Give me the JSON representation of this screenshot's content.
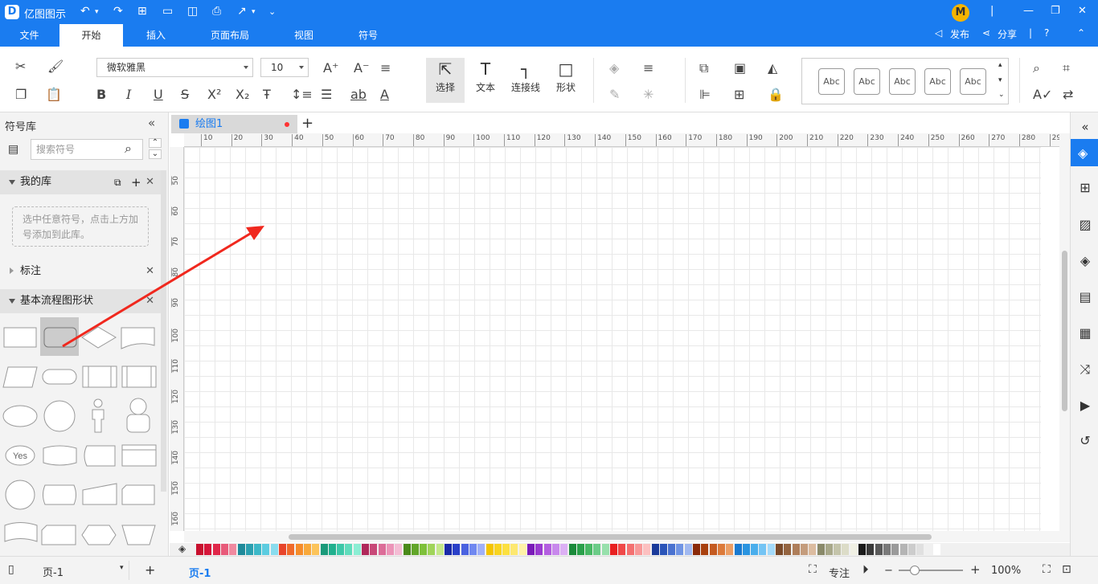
{
  "app": {
    "name": "亿图图示"
  },
  "menu_tabs": [
    "文件",
    "开始",
    "插入",
    "页面布局",
    "视图",
    "符号"
  ],
  "active_tab": "开始",
  "header_right": {
    "publish": "发布",
    "share": "分享",
    "avatar_letter": "M"
  },
  "ribbon": {
    "font_name": "微软雅黑",
    "font_size": "10",
    "tools": {
      "select": "选择",
      "text": "文本",
      "connector": "连接线",
      "shape": "形状"
    },
    "style_samples": [
      "Abc",
      "Abc",
      "Abc",
      "Abc",
      "Abc"
    ]
  },
  "left_panel": {
    "title": "符号库",
    "search_placeholder": "搜索符号",
    "my_library": "我的库",
    "my_library_hint": "选中任意符号，点击上方加号添加到此库。",
    "annotation": "标注",
    "basic_flowchart": "基本流程图形状",
    "yes_label": "Yes"
  },
  "document": {
    "tab_name": "绘图1"
  },
  "ruler": {
    "h_ticks": [
      "10",
      "20",
      "30",
      "40",
      "50",
      "60",
      "70",
      "80",
      "90",
      "100",
      "110",
      "120",
      "130",
      "140",
      "150",
      "160",
      "170",
      "180",
      "190",
      "200",
      "210",
      "220",
      "230",
      "240",
      "250",
      "260",
      "270",
      "280",
      "29"
    ],
    "v_ticks": [
      "50",
      "60",
      "70",
      "80",
      "90",
      "100",
      "110",
      "120",
      "130",
      "140",
      "150",
      "160"
    ]
  },
  "status": {
    "page_select": "页-1",
    "page_tab": "页-1",
    "focus": "专注",
    "zoom": "100%"
  },
  "palette": [
    "#c8102e",
    "#d6163a",
    "#e0284a",
    "#e85a7a",
    "#f08aa0",
    "#1e8a9a",
    "#2aa0b0",
    "#3cb8c8",
    "#5ccce0",
    "#8adcee",
    "#e8442a",
    "#f06a2a",
    "#f58c2a",
    "#f8a83a",
    "#fcc45a",
    "#1a9a7a",
    "#20b08e",
    "#3cc8a8",
    "#60dcbc",
    "#8ceed4",
    "#b0285a",
    "#c84878",
    "#dc6c98",
    "#ec94b8",
    "#f4bcd4",
    "#4a8a1a",
    "#62a62a",
    "#7ec03a",
    "#a0d45a",
    "#c4e88a",
    "#1a2aa8",
    "#2a40c8",
    "#4a62e0",
    "#7088f0",
    "#a0b0f8",
    "#f4c400",
    "#f8d420",
    "#fce040",
    "#fde870",
    "#fef2a8",
    "#7a1ab8",
    "#9a3ad0",
    "#b45ee0",
    "#c888ec",
    "#dcb0f4",
    "#1a8a3a",
    "#2aa04a",
    "#48b864",
    "#6ccc88",
    "#98e0ac",
    "#e82020",
    "#f04848",
    "#f47070",
    "#f89898",
    "#fcc0c0",
    "#1a3a9a",
    "#2a54b8",
    "#4a72d0",
    "#7094e4",
    "#a0b8f0",
    "#8a2a0a",
    "#a8400e",
    "#c45a20",
    "#dc7a3a",
    "#ec9e64",
    "#1a7ad0",
    "#2a94e0",
    "#4aaeec",
    "#74c4f4",
    "#a4dafa",
    "#7a4a2a",
    "#946440",
    "#ae7e5a",
    "#c49c7c",
    "#dcbca0",
    "#8a8a6a",
    "#a8a88a",
    "#c4c4aa",
    "#dcdcc8",
    "#f0f0e4",
    "#1a1a1a",
    "#3a3a3a",
    "#5a5a5a",
    "#7a7a7a",
    "#9a9a9a",
    "#b4b4b4",
    "#cccccc",
    "#e0e0e0",
    "#f0f0f0",
    "#ffffff"
  ]
}
